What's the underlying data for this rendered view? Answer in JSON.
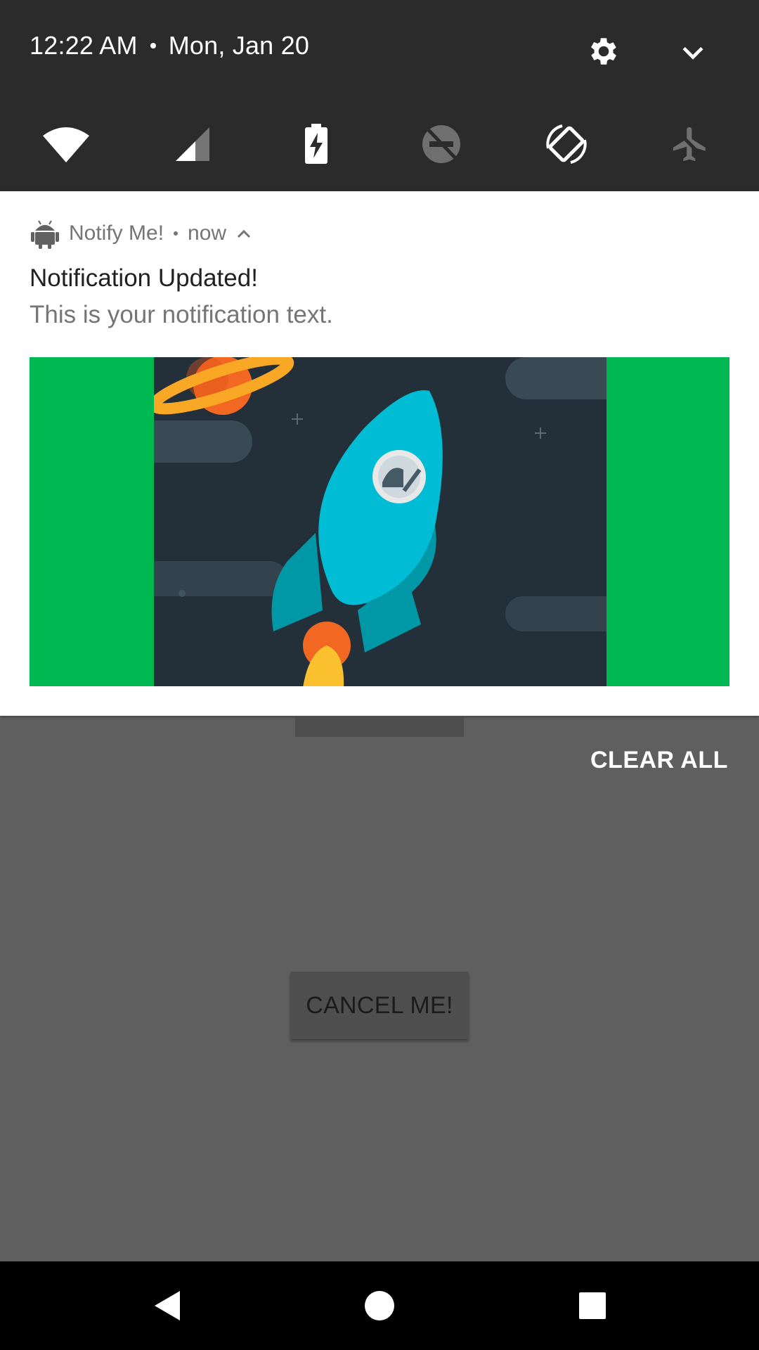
{
  "status": {
    "time": "12:22 AM",
    "date": "Mon, Jan 20"
  },
  "quick_settings": {
    "tiles": [
      {
        "icon": "wifi-icon"
      },
      {
        "icon": "cell-signal-icon"
      },
      {
        "icon": "battery-charging-icon"
      },
      {
        "icon": "do-not-disturb-icon"
      },
      {
        "icon": "auto-rotate-icon"
      },
      {
        "icon": "airplane-mode-icon"
      }
    ]
  },
  "notification": {
    "app_name": "Notify Me!",
    "when": "now",
    "title": "Notification Updated!",
    "text": "This is your notification text.",
    "image_bg_color": "#00b851"
  },
  "actions": {
    "clear_all": "CLEAR ALL",
    "cancel": "CANCEL ME!"
  },
  "colors": {
    "qs_bg": "#2b2b2b",
    "scrim": "#5f5f5f",
    "accent_green": "#00b851",
    "rocket": "#00bcd4"
  }
}
